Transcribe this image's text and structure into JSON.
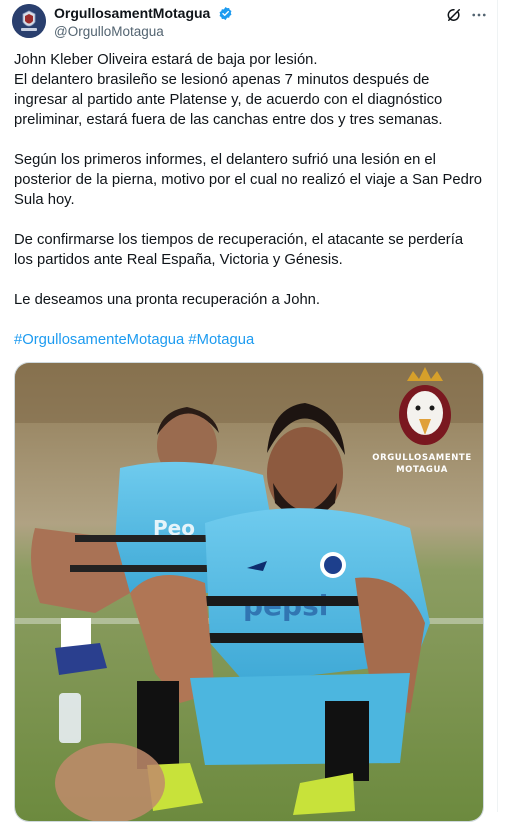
{
  "tweet": {
    "display_name": "OrgullosamentMotagua",
    "handle": "@OrgulloMotagua",
    "paragraphs": [
      "John Kleber Oliveira estará de baja por lesión.\nEl delantero brasileño se lesionó apenas 7 minutos después de ingresar al partido ante Platense y, de acuerdo con el diagnóstico preliminar, estará fuera de las canchas entre dos y tres semanas.",
      "Según los primeros informes, el delantero sufrió una lesión en el posterior de la pierna, motivo por el cual no realizó el viaje a San Pedro Sula hoy.",
      "De confirmarse los tiempos de recuperación, el atacante se perdería los partidos ante Real España, Victoria y Génesis.",
      "Le deseamos una pronta recuperación a John."
    ],
    "hashtags": [
      "#OrgullosamenteMotagua",
      "#Motagua"
    ]
  },
  "media": {
    "brand_line1": "ORGULLOSAMENTE",
    "brand_line2": "MOTAGUA",
    "jersey_sponsor": "pepsi"
  },
  "icons": {
    "verified": "verified-badge-icon",
    "grok": "grok-icon",
    "more": "more-options-icon"
  },
  "colors": {
    "link": "#1d9bf0",
    "text": "#0f1419",
    "secondary": "#536471",
    "jersey": "#5bc0e6"
  }
}
